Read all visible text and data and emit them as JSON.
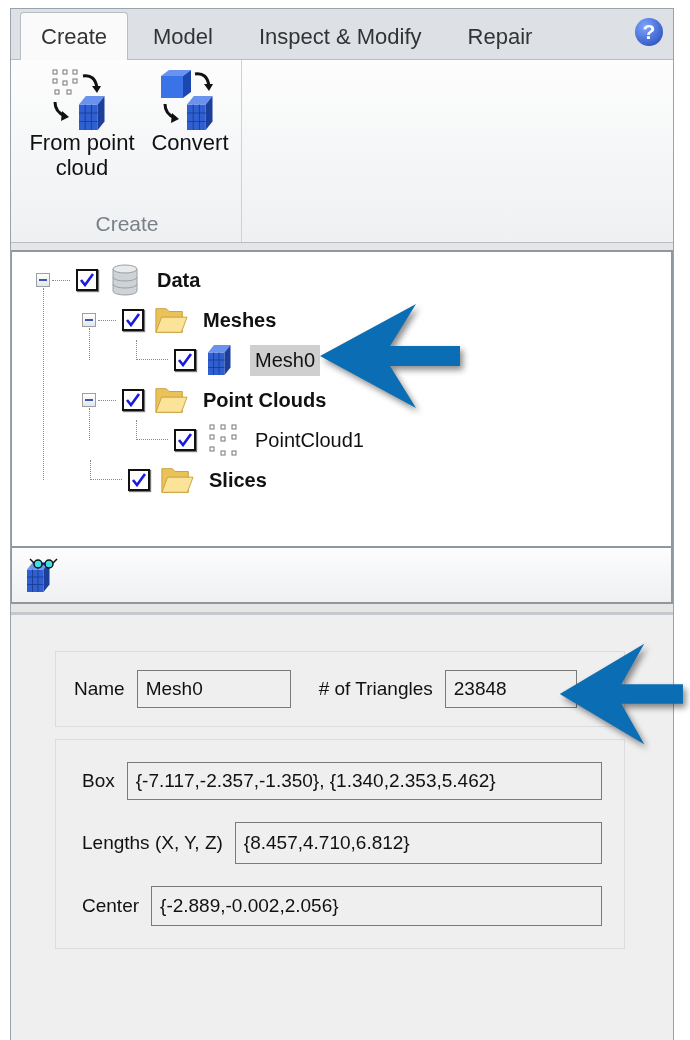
{
  "ribbon": {
    "tabs": [
      {
        "label": "Create",
        "selected": true
      },
      {
        "label": "Model",
        "selected": false
      },
      {
        "label": "Inspect & Modify",
        "selected": false
      },
      {
        "label": "Repair",
        "selected": false
      }
    ],
    "help": "?",
    "buttons": [
      {
        "label": "From point cloud",
        "kind": "from-points"
      },
      {
        "label": "Convert",
        "kind": "convert"
      }
    ],
    "group_label": "Create"
  },
  "tree": [
    {
      "label": "Data",
      "kind": "database",
      "checked": true,
      "expanded": true,
      "selected": false,
      "children": [
        {
          "label": "Meshes",
          "kind": "folder",
          "checked": true,
          "expanded": true,
          "selected": false,
          "children": [
            {
              "label": "Mesh0",
              "kind": "mesh",
              "checked": true,
              "selected": true
            }
          ]
        },
        {
          "label": "Point Clouds",
          "kind": "folder",
          "checked": true,
          "expanded": true,
          "selected": false,
          "children": [
            {
              "label": "PointCloud1",
              "kind": "point-cloud",
              "checked": true,
              "selected": false
            }
          ]
        },
        {
          "label": "Slices",
          "kind": "folder",
          "checked": true,
          "selected": false
        }
      ]
    }
  ],
  "properties": {
    "name": {
      "label": "Name",
      "value": "Mesh0"
    },
    "triangles": {
      "label": "# of Triangles",
      "value": "23848"
    },
    "box": {
      "label": "Box",
      "value": "{-7.117,-2.357,-1.350}, {1.340,2.353,5.462}"
    },
    "lengths": {
      "label": "Lengths (X, Y, Z)",
      "value": "{8.457,4.710,6.812}"
    },
    "center": {
      "label": "Center",
      "value": "{-2.889,-0.002,2.056}"
    }
  }
}
